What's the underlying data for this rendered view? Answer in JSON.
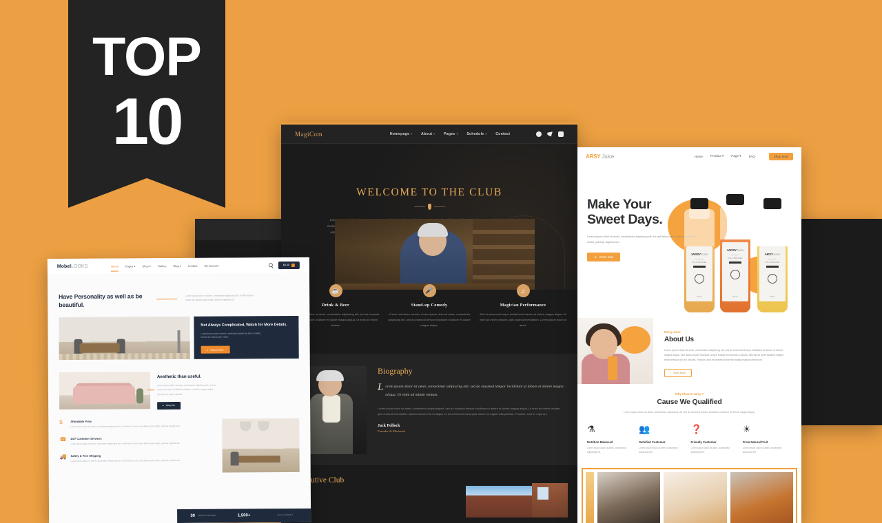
{
  "background": {
    "color": "#eda043"
  },
  "ribbon": {
    "top_label": "TOP",
    "number": "10",
    "bg": "#232323"
  },
  "club_site": {
    "logo": "MagiCom",
    "nav": [
      {
        "label": "Homepage",
        "caret": "▾"
      },
      {
        "label": "About",
        "caret": "▾"
      },
      {
        "label": "Pages",
        "caret": "▾"
      },
      {
        "label": "Schedule",
        "caret": "▾"
      },
      {
        "label": "Contact",
        "caret": ""
      }
    ],
    "social": [
      "facebook-icon",
      "twitter-icon",
      "youtube-icon"
    ],
    "hero": {
      "title": "WELCOME TO THE CLUB",
      "paragraph": "Lorem ipsum dolor sit amet, consectetur adipiscing elit, sed do eiusmod tempor incididunt ut labore et dolore magna aliqua. Ut enim ad minim veniam, quis nostrud exercitation ullamco laboris nisi ut aliquip ex ea commodo consequat. Duis aute irure dolor in reprehenderit in voluptate velit esse cillum dolore eu fugiat nulla pariatur. Excepteur sint occaecat cupidatat non proident, sunt in culpa qui officia deserunt mollit anim id est laborum."
    },
    "features": [
      {
        "icon": "☕",
        "title": "Drink & Beer",
        "text": "Lorem ipsum dolor sit amet, consectetur adipiscing elit, sed do eiusmod tempor incididunt ut labore et dolore magna aliqua. Ut enim ad minim veniam."
      },
      {
        "icon": "🎤",
        "title": "Stand-up Comedy",
        "text": "Ut enim ad minim veniam, Lorem ipsum dolor sit amet, consectetur adipiscing elit, sed do eiusmod tempor incididunt ut labore et dolore magna aliqua."
      },
      {
        "icon": "♫",
        "title": "Magician Performance",
        "text": "Sed do eiusmod tempor incididunt ut labore et dolore magna aliqua. Ut enim ad minim veniam, quis nostrud exercitation. Lorem ipsum dolor sit amet."
      }
    ],
    "biography": {
      "heading": "Biography",
      "dropcap": "L",
      "lead": "orem ipsum dolor sit amet, consectetur adipiscing elit, sed do eiusmod tempor incididunt ut labore et dolore magna aliqua. Ut enim ad minim veniam.",
      "body": "Lorem ipsum dolor sit amet, consectetur adipiscing elit, sed do eiusmod tempor incididunt ut labore et dolore magna aliqua. Ut enim ad minim veniam, quis nostrud exercitation ullamco laboris nisi ut aliquip ex ea commodo consequat dolore eu fugiat nulla pariatur. Proident, sunt in culpa qui.",
      "signature": "Jack Pollock",
      "role": "Founder & Illusionist"
    },
    "executive": {
      "heading": "Executive Club"
    }
  },
  "back_mockup": {
    "logo": "MagiCom"
  },
  "juice_site": {
    "logo_accent": "ARSY",
    "logo_rest": " Juice",
    "nav": [
      {
        "label": "Home"
      },
      {
        "label": "Product ▾"
      },
      {
        "label": "Page ▾"
      },
      {
        "label": "FAQ"
      }
    ],
    "cta": "Shop Now",
    "hero": {
      "title_line1": "Make Your",
      "title_line2": "Sweet Days.",
      "paragraph": "Lorem ipsum dolor sit amet, consectetur adipiscing elit, sit sed tellus cum is nec sed montes mollis, pulvinar dapibus leo.",
      "button": "Order Now"
    },
    "bottles": [
      {
        "name": "JARSY",
        "suffix": "Juice",
        "sub": "COLD PRESSED",
        "volume": "500 ml",
        "fruit": "mango-icon"
      },
      {
        "name": "JARSY",
        "suffix": "Juice",
        "sub": "COLD PRESSED",
        "volume": "500 ml",
        "fruit": "orange-icon"
      },
      {
        "name": "ARSY",
        "suffix": "Juice",
        "sub": "COLD PRESSED",
        "volume": "500 ml",
        "fruit": "lemon-icon"
      }
    ],
    "about": {
      "eyebrow": "Dorsy Juice",
      "heading": "About Us",
      "paragraph": "Lorem ipsum dolor sit amet, consectetur adipiscing elit, sed do eiusmod tempor incididunt ut labore et dolore magna aliqua. Ved lacinia morbi tincidunt ornare massa et molestie a iaculis. Nisi est sit amet facilisis magna etiam tempor orci eu lobortis. Tempus urna et pharetra pharetra massa massa ultricies mi.",
      "button": "Read More"
    },
    "qualified": {
      "eyebrow": "Why Choose Jarsy ?",
      "heading": "Cause We Qualified",
      "subtext": "Lorem ipsum dolor sit amet, consectetur adipiscing elit, sed do eiusmod tempor incididunt ut labore et dolore magna aliqua.",
      "cards": [
        {
          "icon": "⚗",
          "title": "Nutrition Balanced",
          "text": "Lorem ipsum dolor sit amet, consectetur adipiscing elit."
        },
        {
          "icon": "👥",
          "title": "Satisfied Customer",
          "text": "Lorem ipsum dolor sit amet, consectetur adipiscing elit."
        },
        {
          "icon": "❓",
          "title": "Friendly Customer",
          "text": "Lorem ipsum dolor sit amet, consectetur adipiscing elit."
        },
        {
          "icon": "☀",
          "title": "From Natural Fruit",
          "text": "Lorem ipsum dolor sit amet, consectetur adipiscing elit."
        }
      ]
    },
    "gallery": {
      "next_arrow": "›",
      "count": 4
    }
  },
  "mobel_site": {
    "logo_bold": "Mobel",
    "logo_light": "LOOKS",
    "nav": [
      {
        "label": "Home",
        "active": true
      },
      {
        "label": "Pages ▾",
        "active": false
      },
      {
        "label": "Shop ▾",
        "active": false
      },
      {
        "label": "Gallery",
        "active": false
      },
      {
        "label": "Blog ▾",
        "active": false
      },
      {
        "label": "Contact",
        "active": false
      },
      {
        "label": "My Account",
        "active": false
      }
    ],
    "cart_label": "$0.00",
    "hero": {
      "title": "Have Personality as well as be beautiful.",
      "paragraph": "Lorem ipsum dolor sit amet, consectetur adipiscing elit, sit nibh lacinia turpis nec ullamcorper mattis, pulvinar dapibus leo."
    },
    "promo": {
      "title": "Not Always Complicated, Watch for More Details.",
      "text": "Lorem ipsum dolor sit amet, consectetur adipiscing elit ut sit tellus lacinia nec ullamcorper mattis.",
      "button": "Explore Now"
    },
    "section2": {
      "title": "Aesthetic than useful.",
      "text": "Lorem ipsum dolor sit amet, consectetur adipiscing elit, sed do eiusmod tempor incididunt ut labore et dolore magna aliqua. Sit enim est minim veniam.",
      "button": "About Us"
    },
    "features": [
      {
        "icon": "$",
        "title": "Affordable Price",
        "text": "Lorem ipsum dolor sit amet, consectetur adipiscing elit, sit elit lectus luctus nec ullamcorper mattis, pulvinar dapibus leo."
      },
      {
        "icon": "☎",
        "title": "24/7 Customer Services",
        "text": "Lorem ipsum dolor sit amet, consectetur adipiscing elit, sit elit lectus luctus nec ullamcorper mattis, pulvinar dapibus leo."
      },
      {
        "icon": "🚚",
        "title": "Safety & Free Shipping",
        "text": "Lorem ipsum dolor sit amet, consectetur adipiscing elit, sit elit lectus luctus nec ullamcorper mattis, pulvinar dapibus leo."
      }
    ],
    "stats": [
      {
        "value": "30",
        "label": "YEARS EXPERIENCE"
      },
      {
        "value": "1,500+",
        "label": "HAPPY CUSTOMERS"
      },
      {
        "value": "",
        "label": "ITEM IN PRODUCT"
      }
    ]
  }
}
